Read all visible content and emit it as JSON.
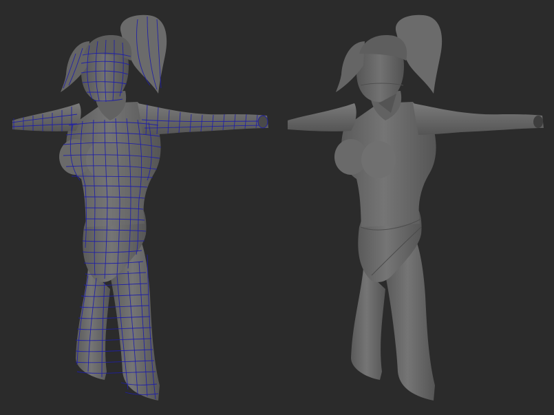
{
  "viewport": {
    "background": "#2b2b2b"
  },
  "models": {
    "left": {
      "shading": "wireframe-on-shaded",
      "surface_color": "#6e6e6e",
      "wire_color": "#1e1ea8"
    },
    "right": {
      "shading": "smooth-shaded",
      "surface_color": "#6a6a6a"
    }
  }
}
